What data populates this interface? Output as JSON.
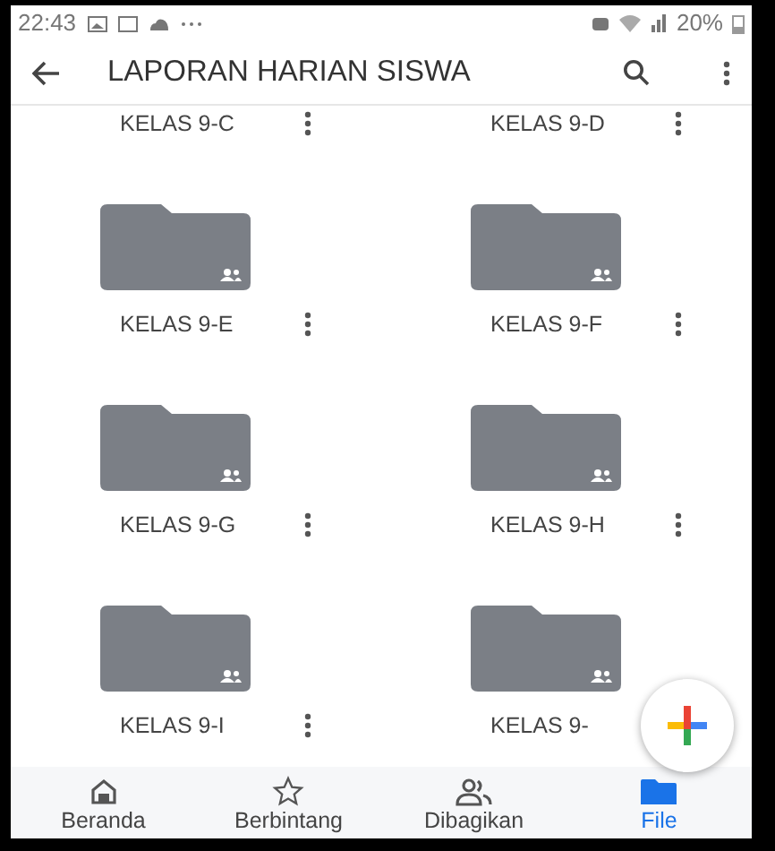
{
  "status_bar": {
    "time": "22:43",
    "battery": "20%"
  },
  "app_bar": {
    "title": "LAPORAN HARIAN SISWA"
  },
  "rows": [
    {
      "kind": "cut",
      "items": [
        {
          "name": "KELAS 9-C",
          "menu": true
        },
        {
          "name": "KELAS 9-D",
          "menu": true
        }
      ]
    },
    {
      "kind": "folder",
      "items": [
        {
          "name": "KELAS 9-E",
          "menu": true
        },
        {
          "name": "KELAS 9-F",
          "menu": true
        }
      ]
    },
    {
      "kind": "folder",
      "items": [
        {
          "name": "KELAS 9-G",
          "menu": true
        },
        {
          "name": "KELAS 9-H",
          "menu": true
        }
      ]
    },
    {
      "kind": "folder",
      "items": [
        {
          "name": "KELAS 9-I",
          "menu": true
        },
        {
          "name": "KELAS 9-",
          "menu": false
        }
      ]
    }
  ],
  "bottom_nav": [
    {
      "kind": "home",
      "label": "Beranda",
      "selected": false
    },
    {
      "kind": "star",
      "label": "Berbintang",
      "selected": false
    },
    {
      "kind": "shared",
      "label": "Dibagikan",
      "selected": false
    },
    {
      "kind": "files",
      "label": "File",
      "selected": true
    }
  ]
}
